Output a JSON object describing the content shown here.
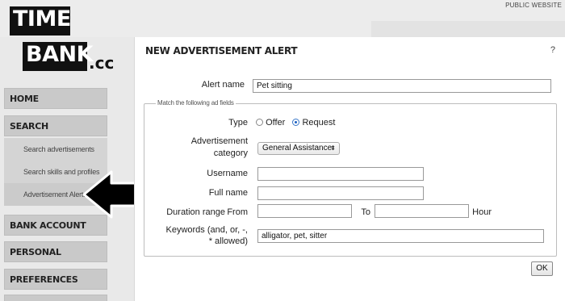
{
  "header": {
    "public_link": "PUBLIC WEBSITE"
  },
  "logo": {
    "line1": "TIME",
    "line2": "BANK",
    "suffix": ".cc"
  },
  "sidebar": {
    "main_items": [
      {
        "label": "HOME"
      },
      {
        "label": "SEARCH"
      },
      {
        "label": "BANK ACCOUNT"
      },
      {
        "label": "PERSONAL"
      },
      {
        "label": "PREFERENCES"
      }
    ],
    "sub_items": [
      {
        "label": "Search advertisements"
      },
      {
        "label": "Search skills and profiles"
      },
      {
        "label": "Advertisement Alerts"
      }
    ]
  },
  "panel": {
    "title": "NEW ADVERTISEMENT ALERT",
    "help": "?",
    "alert_name_label": "Alert name",
    "alert_name_value": "Pet sitting",
    "fieldset_legend": "Match the following ad fields",
    "type_label": "Type",
    "type_options": [
      "Offer",
      "Request"
    ],
    "type_selected": "Request",
    "category_label_line1": "Advertisement",
    "category_label_line2": "category",
    "category_value": "General Assistance",
    "username_label": "Username",
    "username_value": "",
    "fullname_label": "Full name",
    "fullname_value": "",
    "duration_label": "Duration range",
    "duration_from_label": "From",
    "duration_to_label": "To",
    "duration_unit": "Hour",
    "keywords_label_line1": "Keywords (and, or, -,",
    "keywords_label_line2": "* allowed)",
    "keywords_value": "alligator, pet, sitter",
    "ok_label": "OK"
  },
  "colors": {
    "arrow": "#000000",
    "sidebar_bg": "#c9c9c9",
    "selected_radio": "#1a5fc2"
  }
}
